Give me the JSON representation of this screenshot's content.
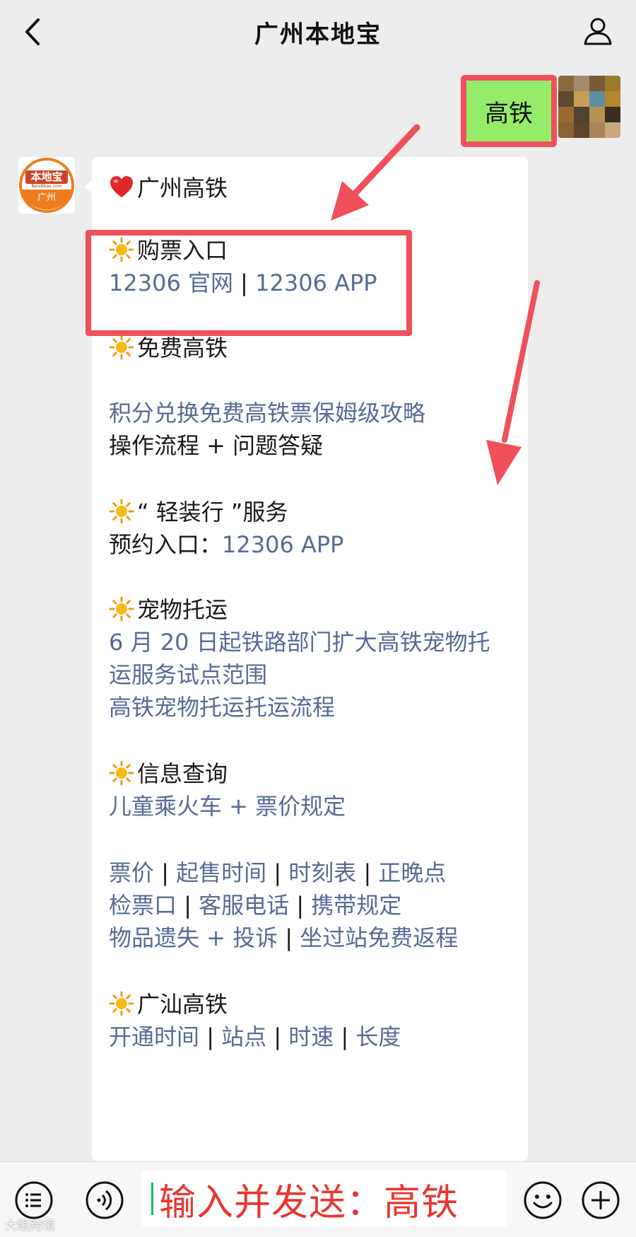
{
  "header": {
    "title": "广州本地宝"
  },
  "outgoing_message": {
    "text": "高铁"
  },
  "bot": {
    "avatar_text": "本地宝",
    "avatar_sub": "Bendibao.com",
    "avatar_city": "广州"
  },
  "message": {
    "title": "广州高铁",
    "sections": [
      {
        "heading": "购票入口",
        "link1": "12306 官网",
        "sep": " | ",
        "link2": "12306 APP"
      },
      {
        "heading": "免费高铁",
        "link": "积分兑换免费高铁票保姆级攻略",
        "text": "操作流程 + 问题答疑"
      },
      {
        "heading": "“ 轻装行 ”服务",
        "label": "预约入口：",
        "link": "12306 APP"
      },
      {
        "heading": "宠物托运",
        "link1a": "6 月 20 日起铁路部门扩大高铁宠物托",
        "link1b": "运服务试点范围",
        "link2": "高铁宠物托运托运流程"
      },
      {
        "heading": "信息查询",
        "link": "儿童乘火车 + 票价规定",
        "row1": [
          "票价",
          "起售时间",
          "时刻表",
          "正晚点"
        ],
        "row2": [
          "检票口",
          "客服电话",
          "携带规定"
        ],
        "row3": [
          "物品遗失 + 投诉",
          "坐过站免费返程"
        ]
      },
      {
        "heading": "广汕高铁",
        "row": [
          "开通时间",
          "站点",
          "时速",
          "长度"
        ]
      }
    ]
  },
  "input": {
    "text": "输入并发送：高铁"
  },
  "watermark": "大眼跨境"
}
